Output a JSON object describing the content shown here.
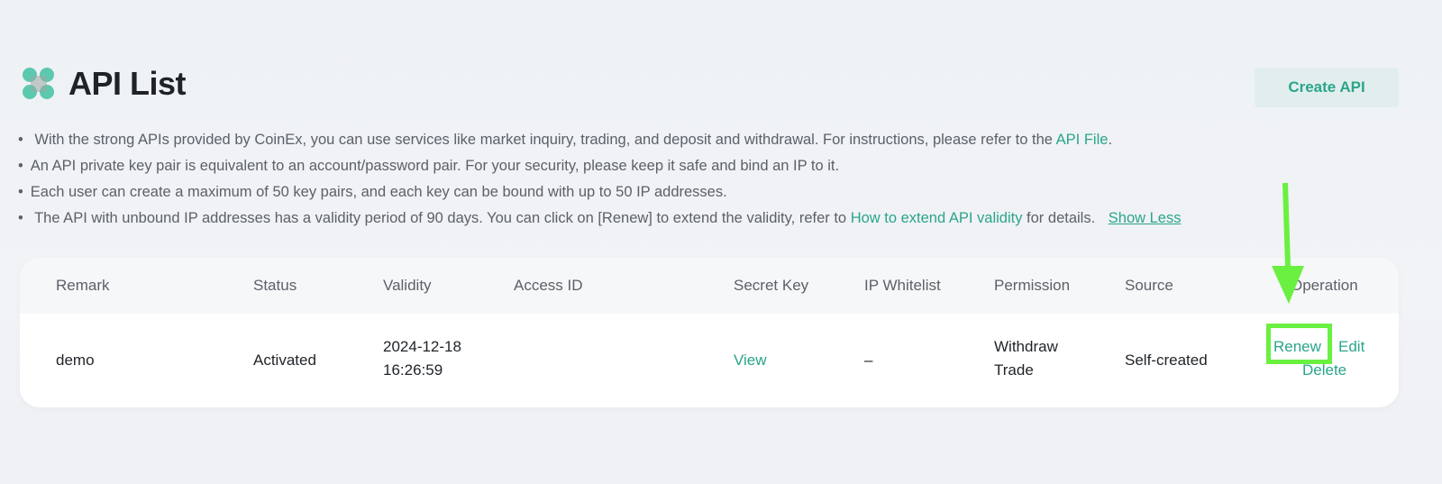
{
  "header": {
    "title": "API List",
    "create_button": "Create API"
  },
  "notes": {
    "line1_pre": "With the strong APIs provided by CoinEx, you can use services like market inquiry, trading, and deposit and withdrawal. For instructions, please refer to the",
    "line1_link": "API File",
    "line1_post": ".",
    "line2": "An API private key pair is equivalent to an account/password pair. For your security, please keep it safe and bind an IP to it.",
    "line3": "Each user can create a maximum of 50 key pairs, and each key can be bound with up to 50 IP addresses.",
    "line4_pre": "The API with unbound IP addresses has a validity period of 90 days. You can click on [Renew] to extend the validity, refer to",
    "line4_link": "How to extend API validity",
    "line4_post": "for details.",
    "show_less": "Show Less"
  },
  "table": {
    "columns": {
      "remark": "Remark",
      "status": "Status",
      "validity": "Validity",
      "access_id": "Access ID",
      "secret_key": "Secret Key",
      "ip_whitelist": "IP Whitelist",
      "permission": "Permission",
      "source": "Source",
      "operation": "Operation"
    },
    "rows": [
      {
        "remark": "demo",
        "status": "Activated",
        "validity_date": "2024-12-18",
        "validity_time": "16:26:59",
        "access_id": "",
        "secret_key": "View",
        "ip_whitelist": "–",
        "permission_1": "Withdraw",
        "permission_2": "Trade",
        "source": "Self-created",
        "op_renew": "Renew",
        "op_edit": "Edit",
        "op_delete": "Delete"
      }
    ]
  },
  "annotation": {
    "color": "#6af040"
  }
}
